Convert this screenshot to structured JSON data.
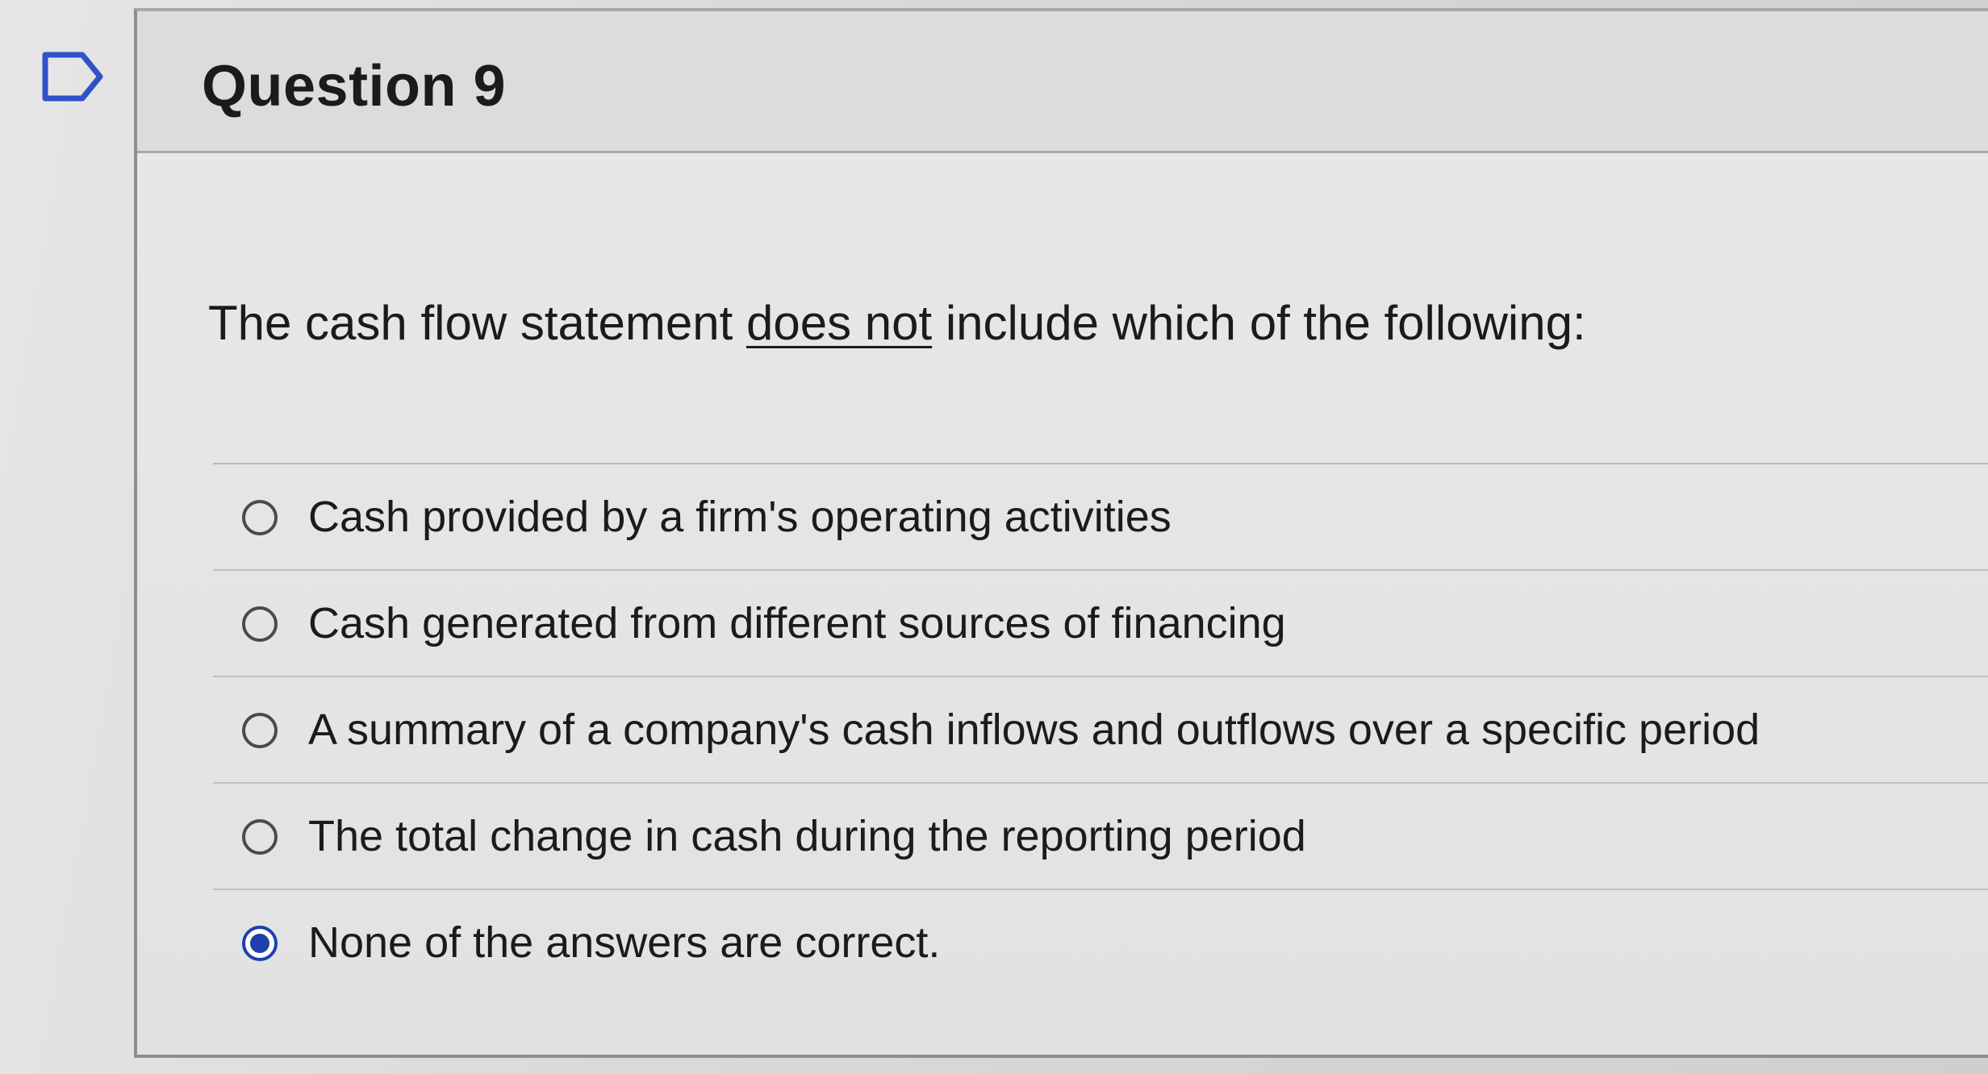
{
  "question": {
    "title": "Question 9",
    "prompt_before": "The cash flow statement ",
    "prompt_emphasis": "does not",
    "prompt_after": " include which of the following:"
  },
  "answers": [
    {
      "label": "Cash provided by a firm's operating activities",
      "selected": false
    },
    {
      "label": "Cash generated from different sources of financing",
      "selected": false
    },
    {
      "label": "A summary of a company's cash inflows and outflows over a specific period",
      "selected": false
    },
    {
      "label": "The total change in cash during the reporting period",
      "selected": false
    },
    {
      "label": "None of the answers are correct.",
      "selected": true
    }
  ],
  "colors": {
    "accent": "#1f3fae",
    "flag_outline": "#2f52c8"
  },
  "icons": {
    "flag": "bookmark-flag-icon"
  }
}
